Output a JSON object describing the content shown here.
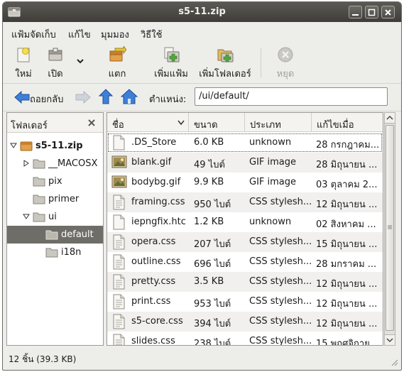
{
  "window": {
    "title": "s5-11.zip"
  },
  "menubar": {
    "items": [
      "แฟ้มจัดเก็บ",
      "แก้ไข",
      "มุมมอง",
      "วิธีใช้"
    ]
  },
  "toolbar": {
    "new_label": "ใหม่",
    "open_label": "เปิด",
    "extract_label": "แตก",
    "add_files_label": "เพิ่มแฟ้ม",
    "add_folder_label": "เพิ่มโฟลเดอร์",
    "stop_label": "หยุด"
  },
  "location": {
    "back_label": "ถอยกลับ",
    "location_label": "ตำแหน่ง:",
    "path": "/ui/default/"
  },
  "sidebar": {
    "title": "โฟลเดอร์",
    "tree": [
      {
        "label": "s5-11.zip",
        "bold": true
      },
      {
        "label": "__MACOSX"
      },
      {
        "label": "pix"
      },
      {
        "label": "primer"
      },
      {
        "label": "ui"
      },
      {
        "label": "default",
        "selected": true
      },
      {
        "label": "i18n"
      }
    ]
  },
  "filelist": {
    "columns": [
      "ชื่อ",
      "ขนาด",
      "ประเภท",
      "แก้ไขเมื่อ"
    ],
    "rows": [
      {
        "name": ".DS_Store",
        "size": "6.0 KB",
        "type": "unknown",
        "modified": "28 กรกฎาคม...",
        "icon": "generic-file-icon"
      },
      {
        "name": "blank.gif",
        "size": "49 ไบต์",
        "type": "GIF image",
        "modified": "28 มิถุนายน ...",
        "icon": "image-file-icon"
      },
      {
        "name": "bodybg.gif",
        "size": "9.9 KB",
        "type": "GIF image",
        "modified": "03 ตุลาคม 2...",
        "icon": "image-file-icon"
      },
      {
        "name": "framing.css",
        "size": "950 ไบต์",
        "type": "CSS stylesh...",
        "modified": "12 มิถุนายน ...",
        "icon": "text-file-icon"
      },
      {
        "name": "iepngfix.htc",
        "size": "1.2 KB",
        "type": "unknown",
        "modified": "02 สิงหาคม ...",
        "icon": "generic-file-icon"
      },
      {
        "name": "opera.css",
        "size": "207 ไบต์",
        "type": "CSS stylesh...",
        "modified": "15 มิถุนายน ...",
        "icon": "text-file-icon"
      },
      {
        "name": "outline.css",
        "size": "696 ไบต์",
        "type": "CSS stylesh...",
        "modified": "28 มกราคม ...",
        "icon": "text-file-icon"
      },
      {
        "name": "pretty.css",
        "size": "3.5 KB",
        "type": "CSS stylesh...",
        "modified": "12 มิถุนายน ...",
        "icon": "text-file-icon"
      },
      {
        "name": "print.css",
        "size": "953 ไบต์",
        "type": "CSS stylesh...",
        "modified": "12 มิถุนายน ...",
        "icon": "text-file-icon"
      },
      {
        "name": "s5-core.css",
        "size": "394 ไบต์",
        "type": "CSS stylesh...",
        "modified": "12 มิถุนายน ...",
        "icon": "text-file-icon"
      },
      {
        "name": "slides.css",
        "size": "238 ไบต์",
        "type": "CSS stylesh...",
        "modified": "15 พฤศจิกาย...",
        "icon": "text-file-icon"
      }
    ]
  },
  "status": {
    "text": "12 ชิ้น  (39.3 KB)"
  },
  "colors": {
    "titlebar": "#4b4a45",
    "selection": "#6e6d68",
    "accent_blue": "#2f6fd6"
  }
}
